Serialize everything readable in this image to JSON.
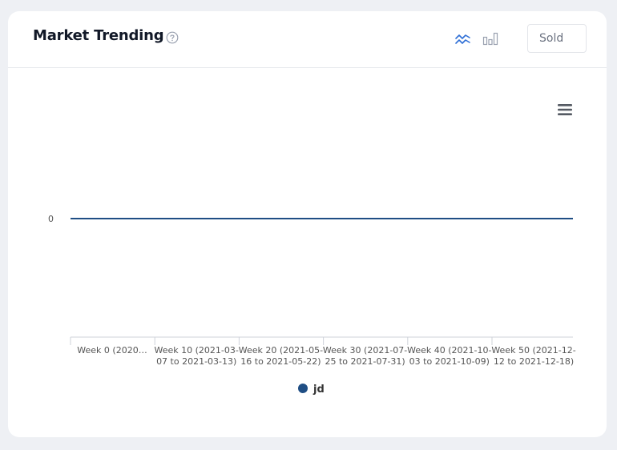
{
  "widget": {
    "title": "Market Trending",
    "help_icon": "question-circle-icon",
    "view_icons": {
      "line": "line-chart-icon",
      "bar": "bar-chart-icon"
    },
    "metric_selected": "Sold",
    "menu_icon": "hamburger-menu-icon"
  },
  "colors": {
    "series": "#1f4e84",
    "active_icon": "#2f6fd6",
    "inactive_icon": "#9aa1b0"
  },
  "chart_data": {
    "type": "line",
    "title": "",
    "xlabel": "",
    "ylabel": "",
    "x": [
      "Week 0 (2020…",
      "Week 10 (2021-03-07 to 2021-03-13)",
      "Week 20 (2021-05-16 to 2021-05-22)",
      "Week 30 (2021-07-25 to 2021-07-31)",
      "Week 40 (2021-10-03 to 2021-10-09)",
      "Week 50 (2021-12-12 to 2021-12-18)"
    ],
    "tick_lines": [
      [
        "Week 0 (2020…",
        ""
      ],
      [
        "Week 10 (2021-03-",
        "07 to 2021-03-13)"
      ],
      [
        "Week 20 (2021-05-",
        "16 to 2021-05-22)"
      ],
      [
        "Week 30 (2021-07-",
        "25 to 2021-07-31)"
      ],
      [
        "Week 40 (2021-10-",
        "03 to 2021-10-09)"
      ],
      [
        "Week 50 (2021-12-",
        "12 to 2021-12-18)"
      ]
    ],
    "y_ticks": [
      "0"
    ],
    "series": [
      {
        "name": "jd",
        "values": [
          0,
          0,
          0,
          0,
          0,
          0
        ]
      }
    ],
    "legend": "bottom-center",
    "grid": false
  }
}
